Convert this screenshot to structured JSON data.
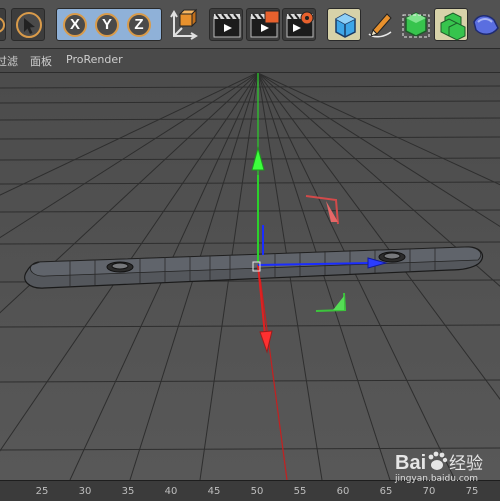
{
  "toolbar": {
    "axis_x": "X",
    "axis_y": "Y",
    "axis_z": "Z",
    "icons": [
      "undo-icon",
      "select-cursor-icon",
      "axis-x-lock",
      "axis-y-lock",
      "axis-z-lock",
      "coordinate-system-icon",
      "render-view-icon",
      "render-picture-viewer-icon",
      "render-settings-icon",
      "cube-icon",
      "pen-spline-icon",
      "subdivision-icon",
      "array-icon",
      "deformer-icon"
    ]
  },
  "menubar": {
    "items": [
      "过滤",
      "面板",
      "ProRender"
    ]
  },
  "viewport": {
    "object": "slotted bar with two holes",
    "axis_colors": {
      "x": "#1a2cff",
      "y": "#2bd12b",
      "z": "#e02020"
    }
  },
  "ruler": {
    "ticks": [
      "25",
      "30",
      "35",
      "40",
      "45",
      "50",
      "55",
      "60",
      "65",
      "70",
      "75"
    ]
  },
  "watermark": {
    "brand": "Bai 经验",
    "url": "jingyan.baidu.com"
  },
  "colors": {
    "toolbar_bg": "#525252",
    "active_bg": "#d7d2a9",
    "axis_group_bg": "#8fb1d8",
    "accent_orange": "#e8912d"
  }
}
